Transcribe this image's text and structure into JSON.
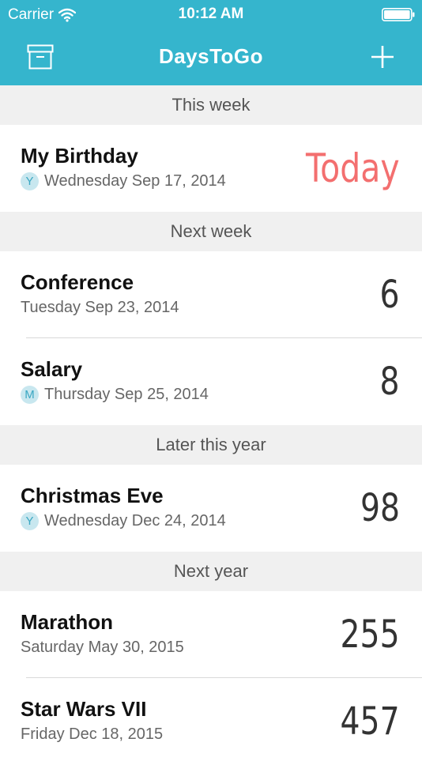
{
  "status_bar": {
    "carrier": "Carrier",
    "time": "10:12 AM",
    "wifi_icon": "wifi-icon",
    "battery_icon": "battery-icon"
  },
  "nav": {
    "title": "DaysToGo",
    "left_icon": "archive-icon",
    "right_icon": "plus-icon"
  },
  "colors": {
    "header_bg": "#35b5cd",
    "today": "#f36f6f",
    "badge_bg": "#c8e7ef",
    "badge_text": "#3aa7c2"
  },
  "sections": [
    {
      "header": "This week",
      "events": [
        {
          "title": "My Birthday",
          "badge": "Y",
          "date": "Wednesday Sep 17, 2014",
          "count": "Today"
        }
      ]
    },
    {
      "header": "Next week",
      "events": [
        {
          "title": "Conference",
          "badge": "",
          "date": "Tuesday Sep 23, 2014",
          "count": "6"
        },
        {
          "title": "Salary",
          "badge": "M",
          "date": "Thursday Sep 25, 2014",
          "count": "8"
        }
      ]
    },
    {
      "header": "Later this year",
      "events": [
        {
          "title": "Christmas Eve",
          "badge": "Y",
          "date": "Wednesday Dec 24, 2014",
          "count": "98"
        }
      ]
    },
    {
      "header": "Next year",
      "events": [
        {
          "title": "Marathon",
          "badge": "",
          "date": "Saturday May 30, 2015",
          "count": "255"
        },
        {
          "title": "Star Wars VII",
          "badge": "",
          "date": "Friday Dec 18, 2015",
          "count": "457"
        }
      ]
    }
  ]
}
